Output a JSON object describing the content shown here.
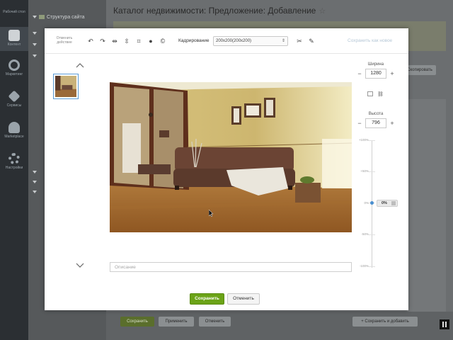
{
  "sidebar": {
    "items": [
      {
        "label": "Рабочий стол",
        "icon": "desktop-icon"
      },
      {
        "label": "Контент",
        "icon": "content-icon"
      },
      {
        "label": "Маркетинг",
        "icon": "target-icon"
      },
      {
        "label": "Сервисы",
        "icon": "layers-icon"
      },
      {
        "label": "Marketplace",
        "icon": "cloud-download-icon"
      },
      {
        "label": "Настройки",
        "icon": "gear-icon"
      }
    ]
  },
  "tree": {
    "root_label": "Структура сайта"
  },
  "page": {
    "title": "Каталог недвижимости: Предложение: Добавление",
    "top_button": "Скопировать"
  },
  "bottom_bar": {
    "save": "Сохранить",
    "apply": "Применить",
    "cancel": "Отменить",
    "save_and_add": "Сохранить и добавить"
  },
  "modal": {
    "toolbar": {
      "cancel_action": "Отменить действие",
      "crop_label": "Кадрирование",
      "crop_value": "200x200(200x200)",
      "save_as_new": "Сохранить как новое"
    },
    "width_label": "Ширина",
    "width_value": "1280",
    "height_label": "Высота",
    "height_value": "796",
    "zoom": {
      "labels": [
        "+100%",
        "+50%",
        "0%",
        "-50%",
        "-100%"
      ],
      "value": "0%"
    },
    "description_placeholder": "Описание",
    "save_button": "Сохранить",
    "cancel_button": "Отменить"
  },
  "colors": {
    "primary_green": "#6ba317",
    "accent_blue": "#4a8fd0"
  }
}
